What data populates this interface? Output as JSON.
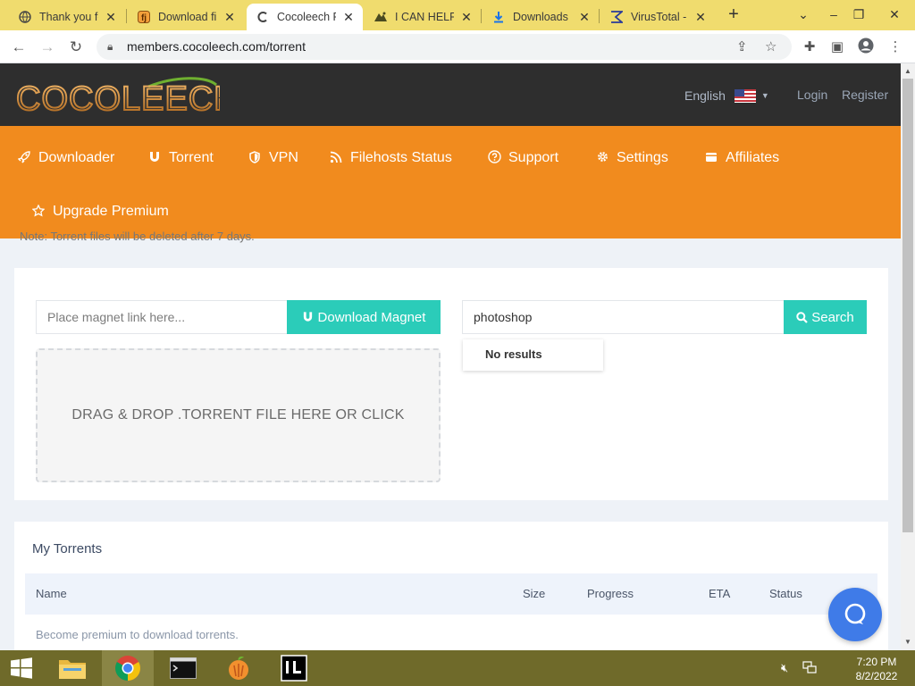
{
  "browser": {
    "tabs": [
      {
        "label": "Thank you fo",
        "icon": "globe-icon"
      },
      {
        "label": "Download fil",
        "icon": "filehost-icon"
      },
      {
        "label": "Cocoleech Pr",
        "icon": "cocoleech-icon"
      },
      {
        "label": "I CAN HELP Y",
        "icon": "tab-site-icon"
      },
      {
        "label": "Downloads",
        "icon": "download-icon"
      },
      {
        "label": "VirusTotal - F",
        "icon": "virustotal-icon"
      }
    ],
    "active_tab_index": 2,
    "url": "members.cocoleech.com/torrent"
  },
  "header": {
    "logo_text": "COCOLEECH",
    "language": "English",
    "login": "Login",
    "register": "Register"
  },
  "nav": {
    "items": [
      {
        "label": "Downloader",
        "icon": "rocket-icon"
      },
      {
        "label": "Torrent",
        "icon": "magnet-icon"
      },
      {
        "label": "VPN",
        "icon": "shield-icon"
      },
      {
        "label": "Filehosts Status",
        "icon": "rss-icon"
      },
      {
        "label": "Support",
        "icon": "help-icon"
      },
      {
        "label": "Settings",
        "icon": "gear-icon"
      },
      {
        "label": "Affiliates",
        "icon": "card-icon"
      }
    ],
    "upgrade": {
      "label": "Upgrade Premium",
      "icon": "star-icon"
    }
  },
  "note": "Note: Torrent files will be deleted after 7 days.",
  "upload": {
    "magnet_placeholder": "Place magnet link here...",
    "magnet_button": "Download Magnet",
    "dropzone_text": "DRAG & DROP .TORRENT FILE HERE OR CLICK"
  },
  "search": {
    "value": "photoshop",
    "button": "Search",
    "results_text": "No results"
  },
  "torrents": {
    "title": "My Torrents",
    "columns": [
      "Name",
      "Size",
      "Progress",
      "ETA",
      "Status"
    ],
    "empty_message": "Become premium to download torrents."
  },
  "taskbar": {
    "time": "7:20 PM",
    "date": "8/2/2022"
  },
  "colors": {
    "nav_orange": "#f18b1e",
    "header_dark": "#2e2e2e",
    "teal_button": "#2bccb9",
    "chat_blue": "#3f7be8",
    "tabstrip_yellow": "#f0dc6e"
  }
}
